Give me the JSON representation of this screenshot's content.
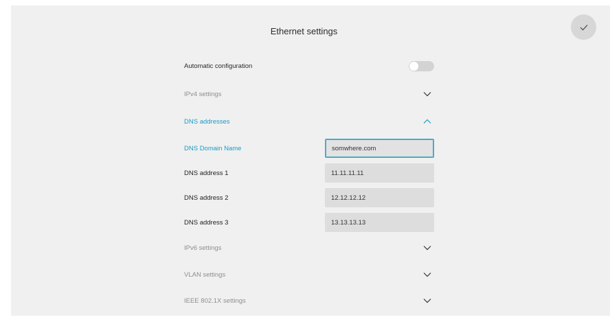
{
  "header": {
    "title": "Ethernet settings",
    "confirm_icon": "checkmark-icon"
  },
  "auto_config": {
    "label": "Automatic configuration",
    "enabled": false
  },
  "sections": {
    "ipv4": {
      "label": "IPv4 settings",
      "expanded": false
    },
    "dns": {
      "label": "DNS addresses",
      "expanded": true
    },
    "ipv6": {
      "label": "IPv6 settings",
      "expanded": false
    },
    "vlan": {
      "label": "VLAN settings",
      "expanded": false
    },
    "ieee": {
      "label": "IEEE 802.1X settings",
      "expanded": false
    }
  },
  "dns_fields": {
    "domain_name": {
      "label": "DNS Domain Name",
      "value": "somwhere.com"
    },
    "address1": {
      "label": "DNS address 1",
      "value": "11.11.11.11"
    },
    "address2": {
      "label": "DNS address 2",
      "value": "12.12.12.12"
    },
    "address3": {
      "label": "DNS address 3",
      "value": "13.13.13.13"
    }
  },
  "colors": {
    "accent": "#1b9cc4",
    "background": "#f0f0f0",
    "field": "#dddddd"
  }
}
